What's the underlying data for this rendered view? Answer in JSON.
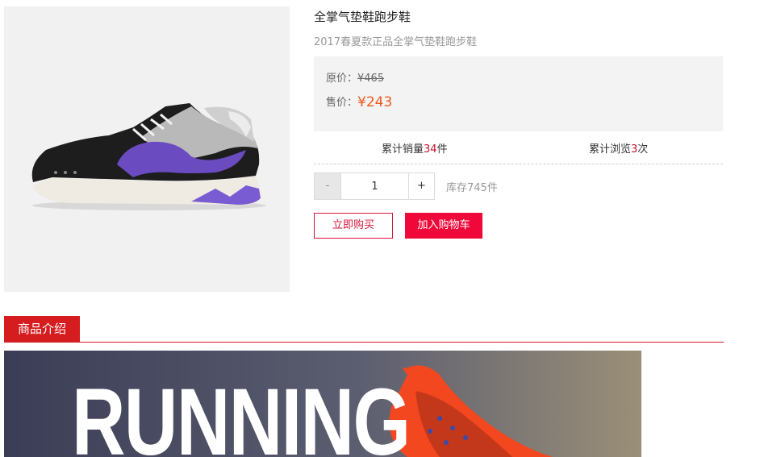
{
  "product": {
    "title": "全掌气垫鞋跑步鞋",
    "subtitle": "2017春夏款正品全掌气垫鞋跑步鞋"
  },
  "pricing": {
    "original_label": "原价：",
    "original_price": "¥465",
    "sale_label": "售价：",
    "sale_price": "¥243"
  },
  "stats": {
    "sales_prefix": "累计销量",
    "sales_count": "34",
    "sales_suffix": "件",
    "views_prefix": "累计浏览",
    "views_count": "3",
    "views_suffix": "次"
  },
  "quantity": {
    "minus_label": "-",
    "value": "1",
    "plus_label": "+"
  },
  "stock_text": "库存745件",
  "actions": {
    "buy_now_label": "立即购买",
    "add_cart_label": "加入购物车"
  },
  "section": {
    "tab_label": "商品介绍"
  },
  "banner": {
    "text": "RUNNING"
  },
  "colors": {
    "accent_red": "#d51d20",
    "buy_red": "#f0083a",
    "sale_orange": "#ee5a1c",
    "count_red": "#c41230",
    "shoe_purple": "#6a4cc0"
  }
}
